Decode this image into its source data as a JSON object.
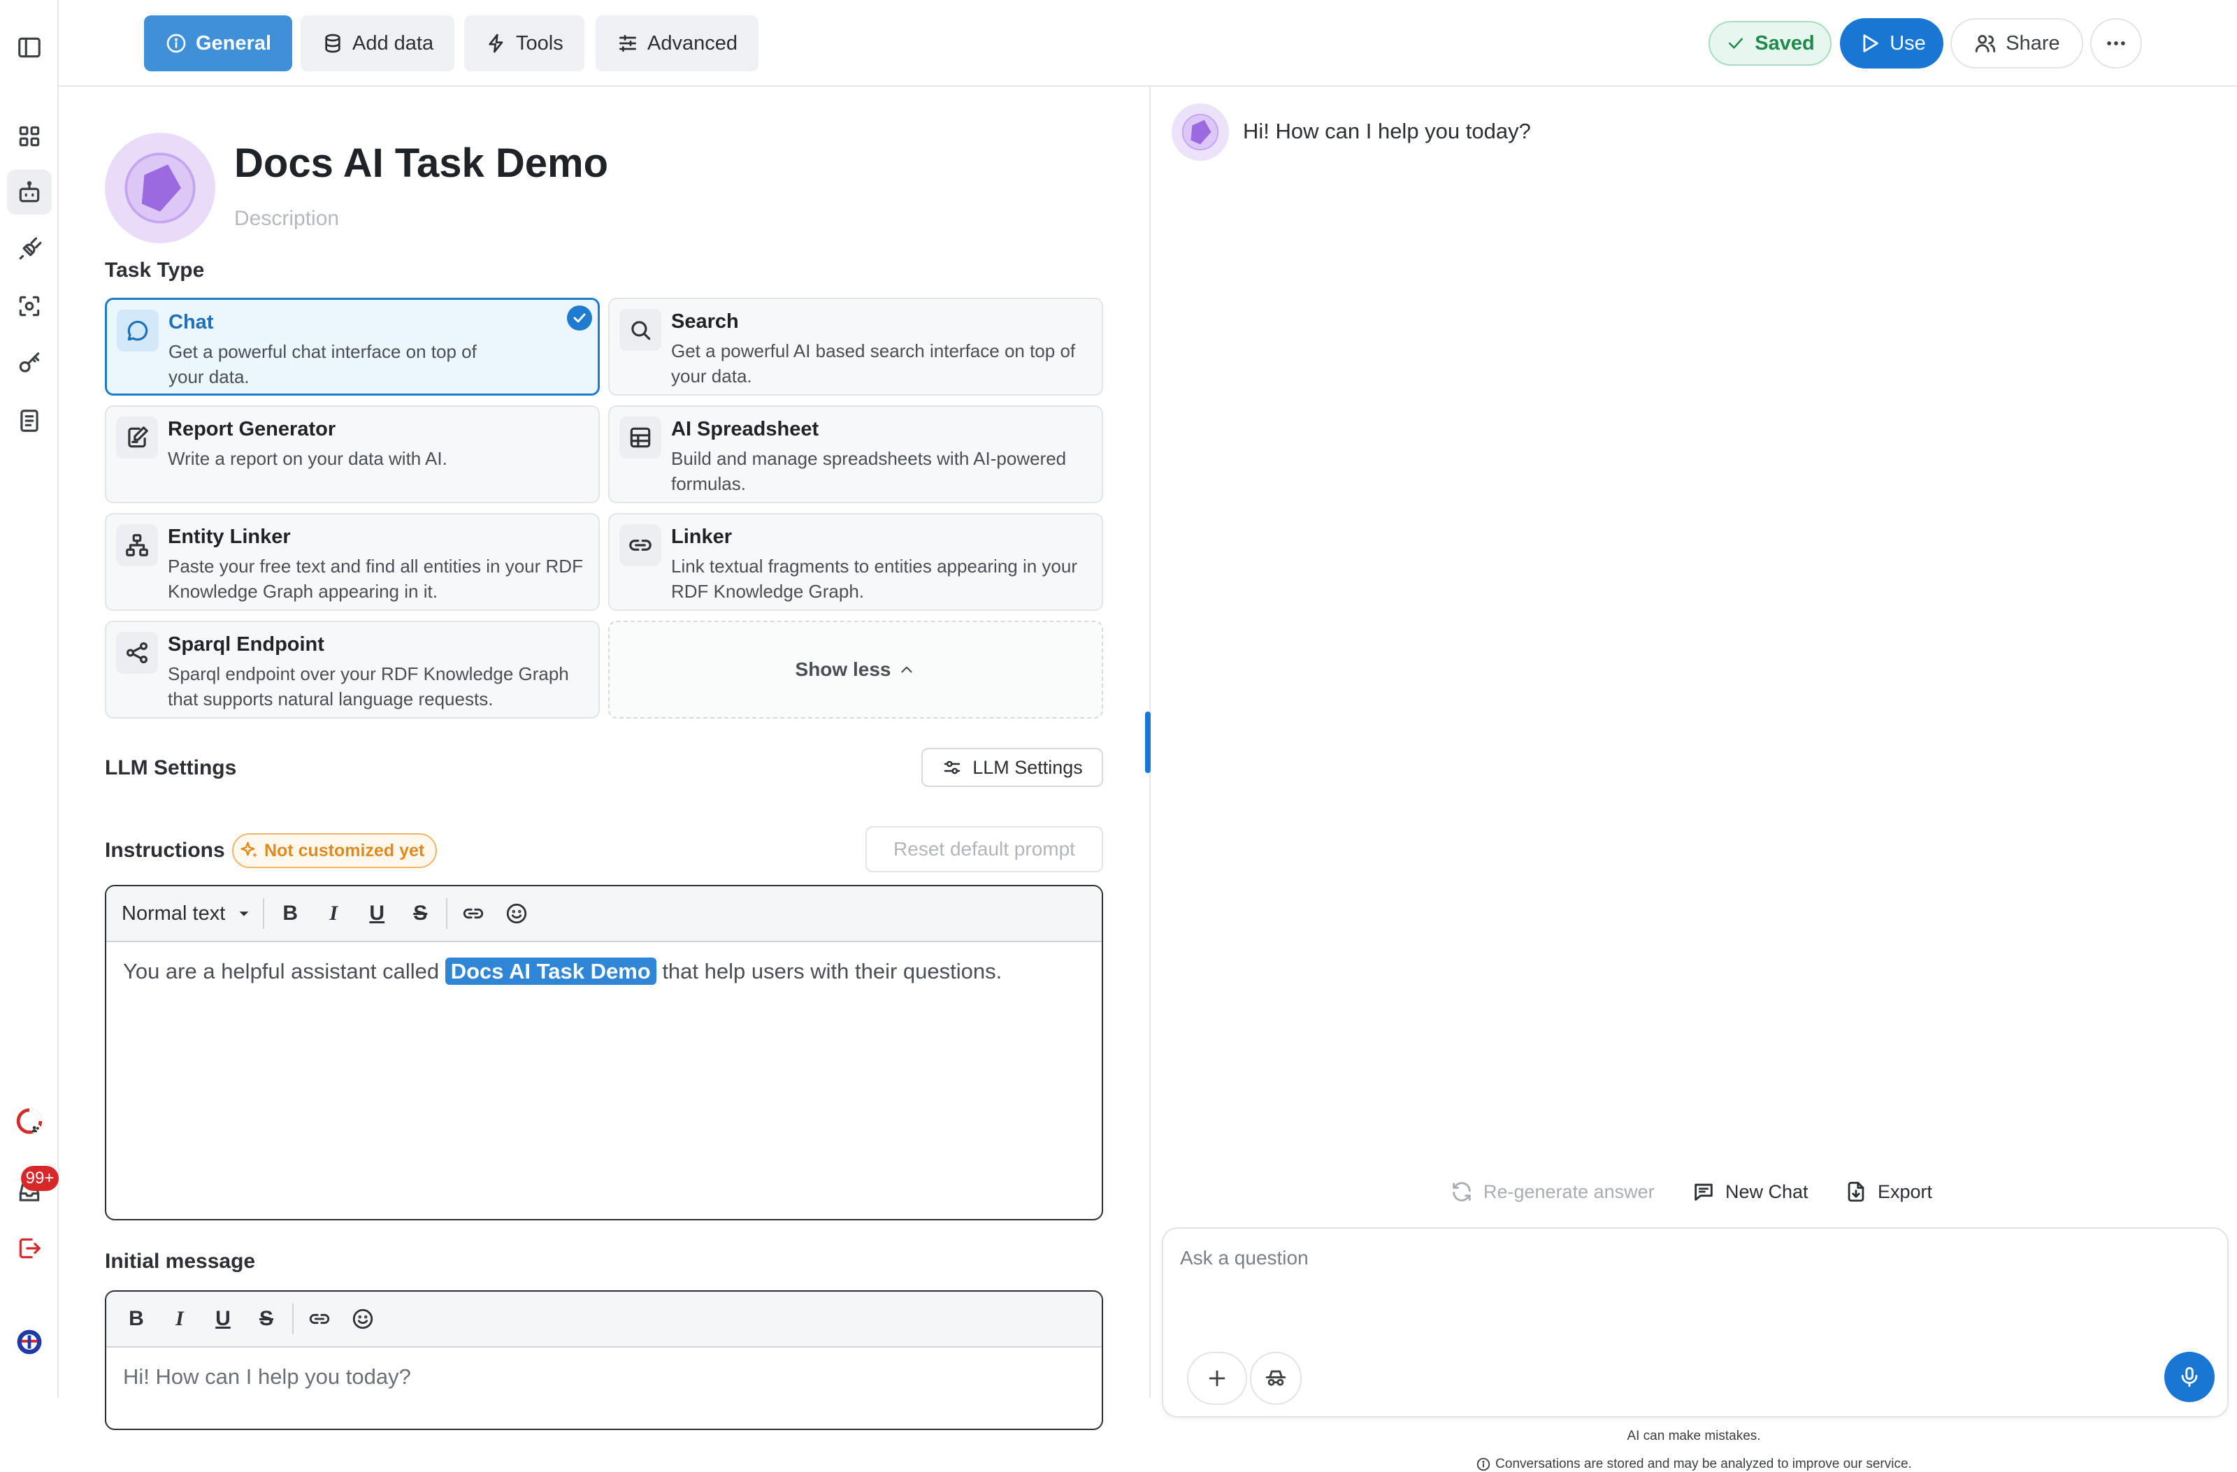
{
  "topbar": {
    "tabs": [
      {
        "label": "General",
        "icon": "info-icon"
      },
      {
        "label": "Add data",
        "icon": "database-icon"
      },
      {
        "label": "Tools",
        "icon": "bolt-icon"
      },
      {
        "label": "Advanced",
        "icon": "sliders-icon"
      }
    ],
    "saved_label": "Saved",
    "use_label": "Use",
    "share_label": "Share"
  },
  "sidebar": {
    "notification_count": "99+"
  },
  "task": {
    "title": "Docs AI Task Demo",
    "description_placeholder": "Description"
  },
  "task_type": {
    "heading": "Task Type",
    "options": [
      {
        "title": "Chat",
        "description": "Get a powerful chat interface on top of your data.",
        "icon": "chat-bubble-icon",
        "selected": true
      },
      {
        "title": "Search",
        "description": "Get a powerful AI based search interface on top of your data.",
        "icon": "search-icon"
      },
      {
        "title": "Report Generator",
        "description": "Write a report on your data with AI.",
        "icon": "edit-document-icon"
      },
      {
        "title": "AI Spreadsheet",
        "description": "Build and manage spreadsheets with AI-powered formulas.",
        "icon": "table-icon"
      },
      {
        "title": "Entity Linker",
        "description": "Paste your free text and find all entities in your RDF Knowledge Graph appearing in it.",
        "icon": "hierarchy-icon"
      },
      {
        "title": "Linker",
        "description": "Link textual fragments to entities appearing in your RDF Knowledge Graph.",
        "icon": "link-icon"
      },
      {
        "title": "Sparql Endpoint",
        "description": "Sparql endpoint over your RDF Knowledge Graph that supports natural language requests.",
        "icon": "share-nodes-icon"
      }
    ],
    "show_less_label": "Show less"
  },
  "llm": {
    "heading": "LLM Settings",
    "button_label": "LLM Settings"
  },
  "instructions": {
    "heading": "Instructions",
    "badge": "Not customized yet",
    "reset_label": "Reset default prompt",
    "format_select": "Normal text",
    "text_before": "You are a helpful assistant called ",
    "text_highlight": "Docs AI Task Demo",
    "text_after": " that help users with their questions."
  },
  "initial_message": {
    "heading": "Initial message",
    "text": "Hi! How can I help you today?"
  },
  "chat": {
    "greeting": "Hi! How can I help you today?",
    "regenerate_label": "Re-generate answer",
    "new_chat_label": "New Chat",
    "export_label": "Export",
    "input_placeholder": "Ask a question",
    "disclaimer": "AI can make mistakes.",
    "privacy_note": "Conversations are stored and may be analyzed to improve our service."
  },
  "colors": {
    "accent": "#1f7bd0",
    "tab_active": "#3f8fd9",
    "saved_bg": "#e7f6ee",
    "saved_text": "#1f8a4c",
    "badge_orange": "#e08a1e",
    "notification_red": "#d62828",
    "mic_blue": "#1976d2"
  }
}
